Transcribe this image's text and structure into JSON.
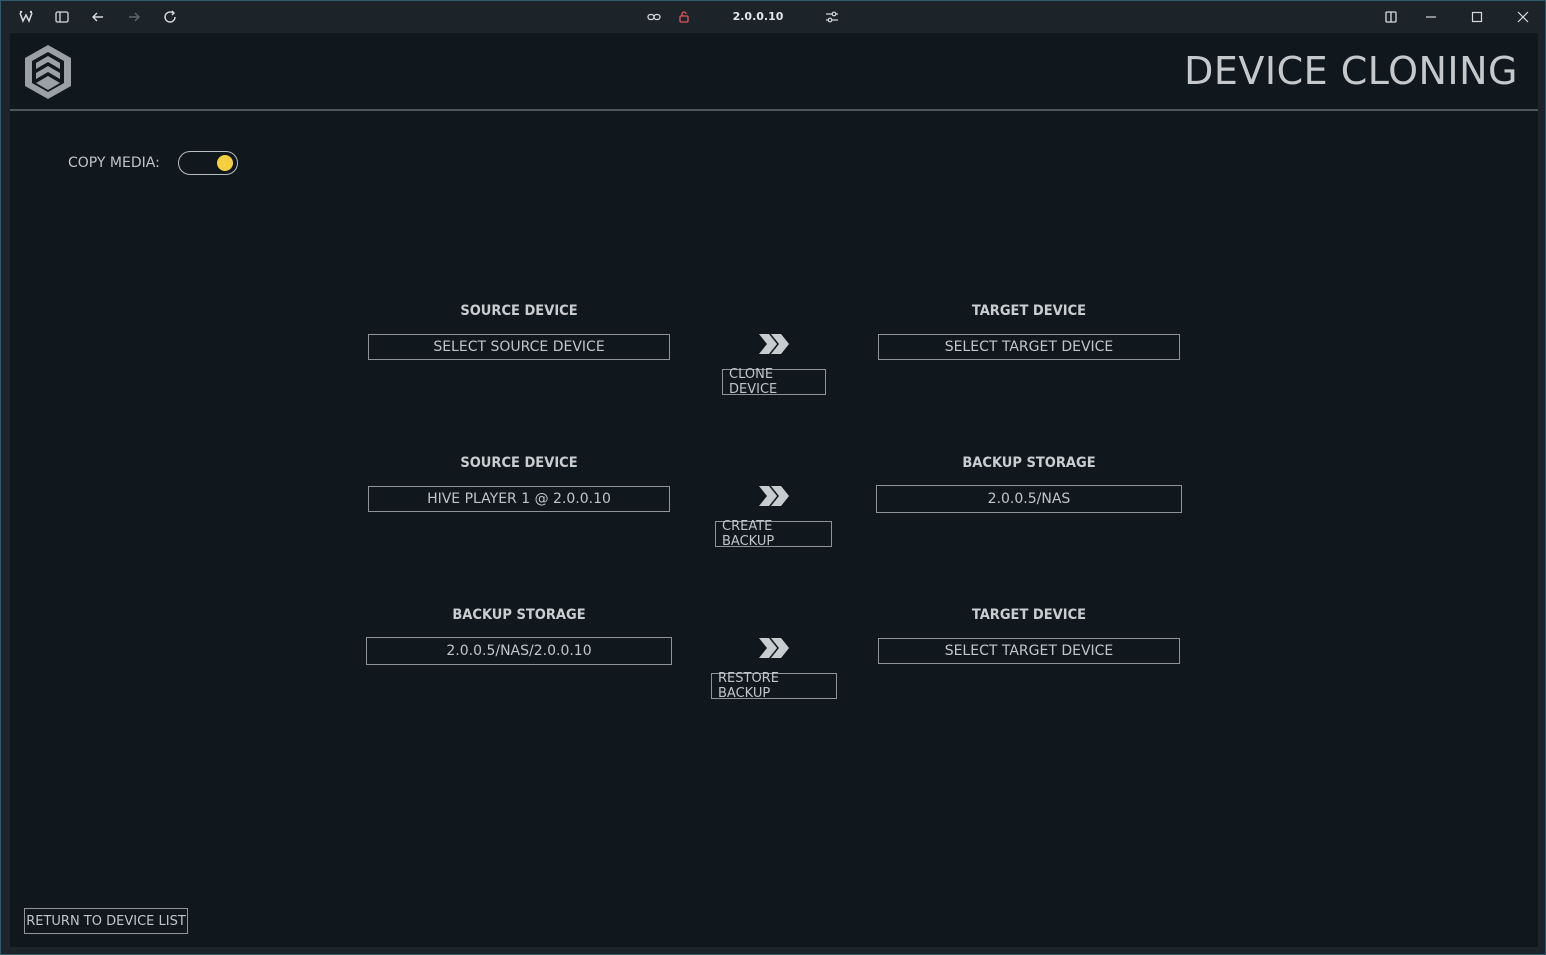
{
  "browser": {
    "url": "2.0.0.10",
    "icons": [
      "app-logo-icon",
      "sidebar-icon",
      "back-icon",
      "forward-icon",
      "reload-icon",
      "link-icon",
      "lock-icon",
      "site-settings-icon",
      "split-view-icon",
      "minimize-icon",
      "maximize-icon",
      "close-icon"
    ]
  },
  "header": {
    "title": "DEVICE CLONING",
    "logo_icon": "hive-shield-logo"
  },
  "options": {
    "copy_media_label": "COPY MEDIA:",
    "copy_media_on": true,
    "toggle_color": "#f4d03f"
  },
  "rows": [
    {
      "left_label": "SOURCE DEVICE",
      "left_value": "SELECT SOURCE DEVICE",
      "action": "CLONE DEVICE",
      "right_label": "TARGET DEVICE",
      "right_value": "SELECT TARGET DEVICE"
    },
    {
      "left_label": "SOURCE DEVICE",
      "left_value": "HIVE PLAYER 1 @ 2.0.0.10",
      "action": "CREATE BACKUP",
      "right_label": "BACKUP STORAGE",
      "right_value": "2.0.0.5/NAS"
    },
    {
      "left_label": "BACKUP STORAGE",
      "left_value": "2.0.0.5/NAS/2.0.0.10",
      "action": "RESTORE BACKUP",
      "right_label": "TARGET DEVICE",
      "right_value": "SELECT TARGET DEVICE"
    }
  ],
  "footer": {
    "return_label": "RETURN TO DEVICE LIST"
  }
}
